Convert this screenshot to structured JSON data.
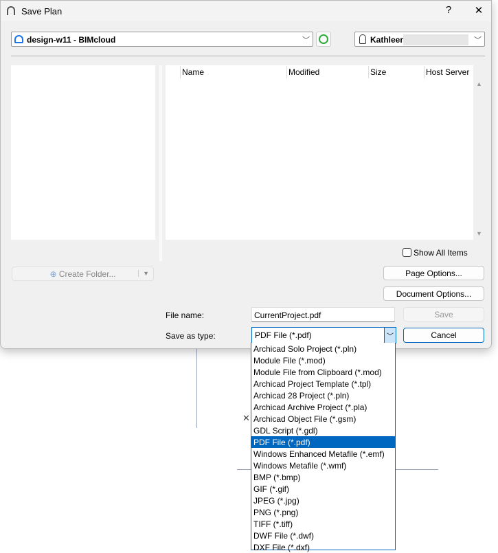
{
  "window": {
    "title": "Save Plan",
    "help": "?",
    "close": "✕"
  },
  "location": {
    "value": "design-w11 - BIMcloud"
  },
  "user": {
    "value": "Kathleen"
  },
  "columns": [
    "Name",
    "Modified",
    "Size",
    "Host Server"
  ],
  "show_all": "Show All Items",
  "create_folder": "Create Folder...",
  "page_options": "Page Options...",
  "document_options": "Document Options...",
  "file_name_label": "File name:",
  "file_name": "CurrentProject.pdf",
  "save_type_label": "Save as type:",
  "save_type": "PDF File (*.pdf)",
  "save": "Save",
  "cancel": "Cancel",
  "types": [
    "Archicad Solo Project (*.pln)",
    "Module File (*.mod)",
    "Module File from Clipboard (*.mod)",
    "Archicad Project Template (*.tpl)",
    "Archicad 28 Project (*.pln)",
    "Archicad Archive Project (*.pla)",
    "Archicad Object File (*.gsm)",
    "GDL Script (*.gdl)",
    "PDF File (*.pdf)",
    "Windows Enhanced Metafile (*.emf)",
    "Windows Metafile (*.wmf)",
    "BMP (*.bmp)",
    "GIF (*.gif)",
    "JPEG (*.jpg)",
    "PNG (*.png)",
    "TIFF (*.tiff)",
    "DWF File (*.dwf)",
    "DXF File (*.dxf)"
  ],
  "selected_type_index": 8
}
